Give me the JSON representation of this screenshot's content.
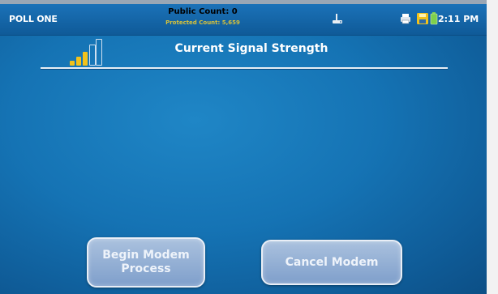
{
  "statusbar": {
    "poll_name": "POLL ONE",
    "public_count": "Public Count: 0",
    "protected_count": "Protected Count: 5,659",
    "time": "2:11 PM",
    "icons": [
      "modem-icon",
      "printer-icon",
      "save-icon",
      "battery-icon"
    ],
    "colors": {
      "save": "#f2c21b",
      "battery": "#7ed04b"
    }
  },
  "main": {
    "title": "Current Signal Strength",
    "signal_bars_lit": 3,
    "signal_bars_total": 5
  },
  "buttons": {
    "begin": "Begin Modem Process",
    "cancel": "Cancel Modem"
  }
}
